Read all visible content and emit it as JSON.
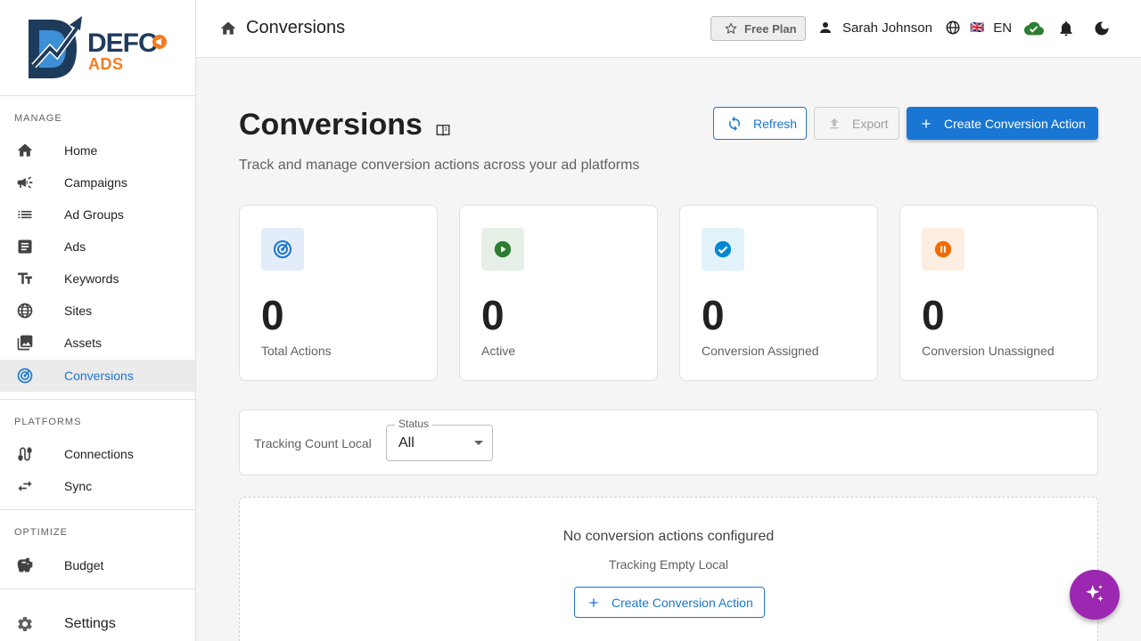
{
  "brand": {
    "name_top": "DEFO",
    "name_bottom": "ADS"
  },
  "sidebar": {
    "sections": [
      {
        "label": "MANAGE"
      },
      {
        "label": "PLATFORMS"
      },
      {
        "label": "OPTIMIZE"
      }
    ],
    "items": [
      {
        "label": "Home",
        "icon": "home-icon"
      },
      {
        "label": "Campaigns",
        "icon": "megaphone-icon"
      },
      {
        "label": "Ad Groups",
        "icon": "list-icon"
      },
      {
        "label": "Ads",
        "icon": "article-icon"
      },
      {
        "label": "Keywords",
        "icon": "text-fields-icon"
      },
      {
        "label": "Sites",
        "icon": "globe-icon"
      },
      {
        "label": "Assets",
        "icon": "image-icon"
      },
      {
        "label": "Conversions",
        "icon": "target-icon",
        "active": true
      },
      {
        "label": "Connections",
        "icon": "cable-icon"
      },
      {
        "label": "Sync",
        "icon": "sync-arrows-icon"
      },
      {
        "label": "Budget",
        "icon": "piggy-bank-icon"
      },
      {
        "label": "Settings",
        "icon": "gear-icon"
      }
    ]
  },
  "topbar": {
    "title": "Conversions",
    "plan": "Free Plan",
    "user": "Sarah Johnson",
    "language_flag": "🇬🇧",
    "language": "EN"
  },
  "page": {
    "title": "Conversions",
    "subtitle": "Track and manage conversion actions across your ad platforms",
    "actions": {
      "refresh": "Refresh",
      "export": "Export",
      "create": "Create Conversion Action"
    }
  },
  "stats": [
    {
      "value": "0",
      "label": "Total Actions",
      "color": "#1976d2",
      "bg": "#e3edf9"
    },
    {
      "value": "0",
      "label": "Active",
      "color": "#2e7d32",
      "bg": "#e6f0e7"
    },
    {
      "value": "0",
      "label": "Conversion Assigned",
      "color": "#0288d1",
      "bg": "#e1f2fb"
    },
    {
      "value": "0",
      "label": "Conversion Unassigned",
      "color": "#ef6c00",
      "bg": "#fdeee1"
    }
  ],
  "filter": {
    "label": "Tracking Count Local",
    "status_legend": "Status",
    "status_value": "All"
  },
  "empty_state": {
    "title": "No conversion actions configured",
    "subtitle": "Tracking Empty Local",
    "button": "Create Conversion Action"
  },
  "colors": {
    "primary": "#1976d2",
    "fab": "#9c27b0",
    "cloud_ok": "#2e7d32"
  }
}
